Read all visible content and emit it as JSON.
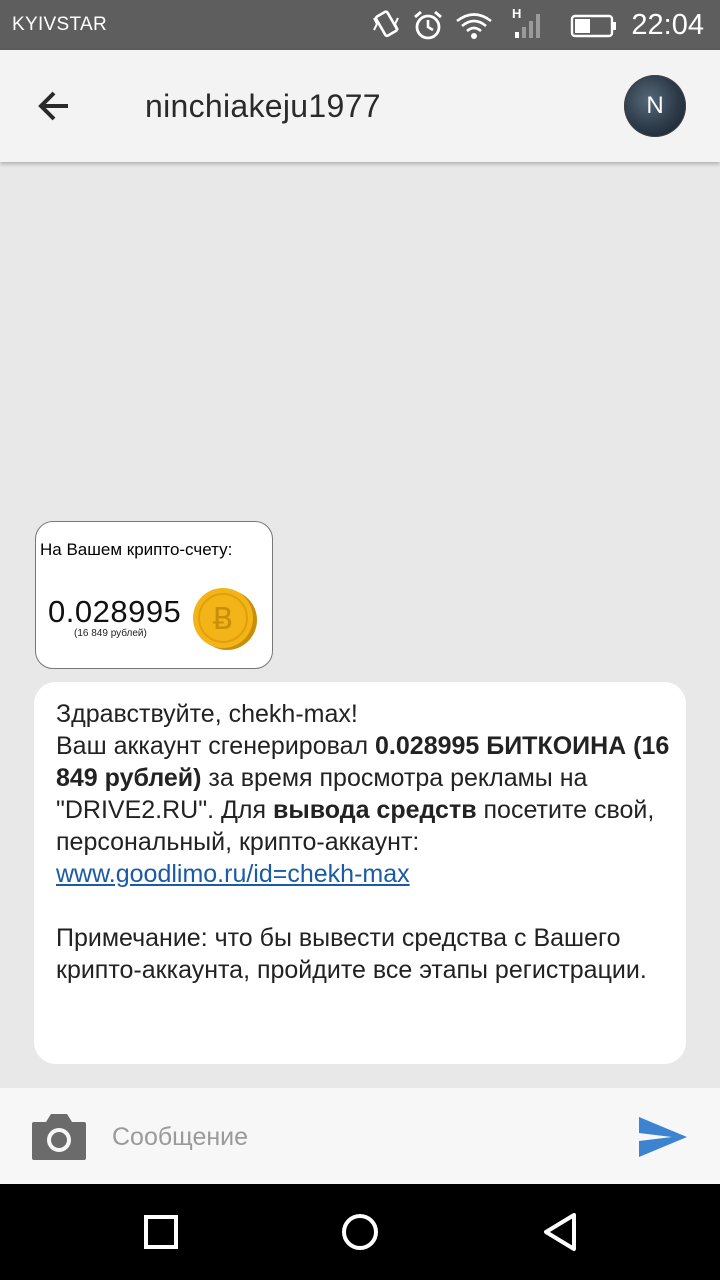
{
  "status_bar": {
    "carrier": "KYIVSTAR",
    "network_type": "H",
    "time": "22:04",
    "icons": [
      "vibrate-icon",
      "alarm-icon",
      "wifi-icon",
      "signal-icon",
      "battery-icon"
    ]
  },
  "header": {
    "title": "ninchiakeju1977",
    "avatar_letter": "N"
  },
  "image_message": {
    "caption": "На Вашем крипто-счету:",
    "amount": "0.028995",
    "rubles": "(16 849 рублей)",
    "icon": "bitcoin-coin-icon"
  },
  "text_message": {
    "line_greeting": "Здравствуйте,  chekh-max!",
    "p1_pre": "Ваш аккаунт сгенерировал ",
    "p1_bold": "0.028995 БИТКОИНА (16 849 рублей)",
    "p1_mid": " за время просмотра рекламы на \"DRIVE2.RU\". Для ",
    "p1_bold2": "вывода средств",
    "p1_post": " посетите свой,  персональный,  крипто-аккаунт:",
    "link": "www.goodlimo.ru/id=chekh-max",
    "note": "Примечание: что бы вывести средства с Вашего крипто-аккаунта,  пройдите все этапы регистрации."
  },
  "composer": {
    "placeholder": "Сообщение",
    "value": ""
  },
  "colors": {
    "status_bar": "#5e5e5e",
    "app_bar": "#f3f3f3",
    "background": "#e8e8e8",
    "link": "#1a5aa6",
    "send": "#3c84d0",
    "coin": "#f2b416"
  }
}
